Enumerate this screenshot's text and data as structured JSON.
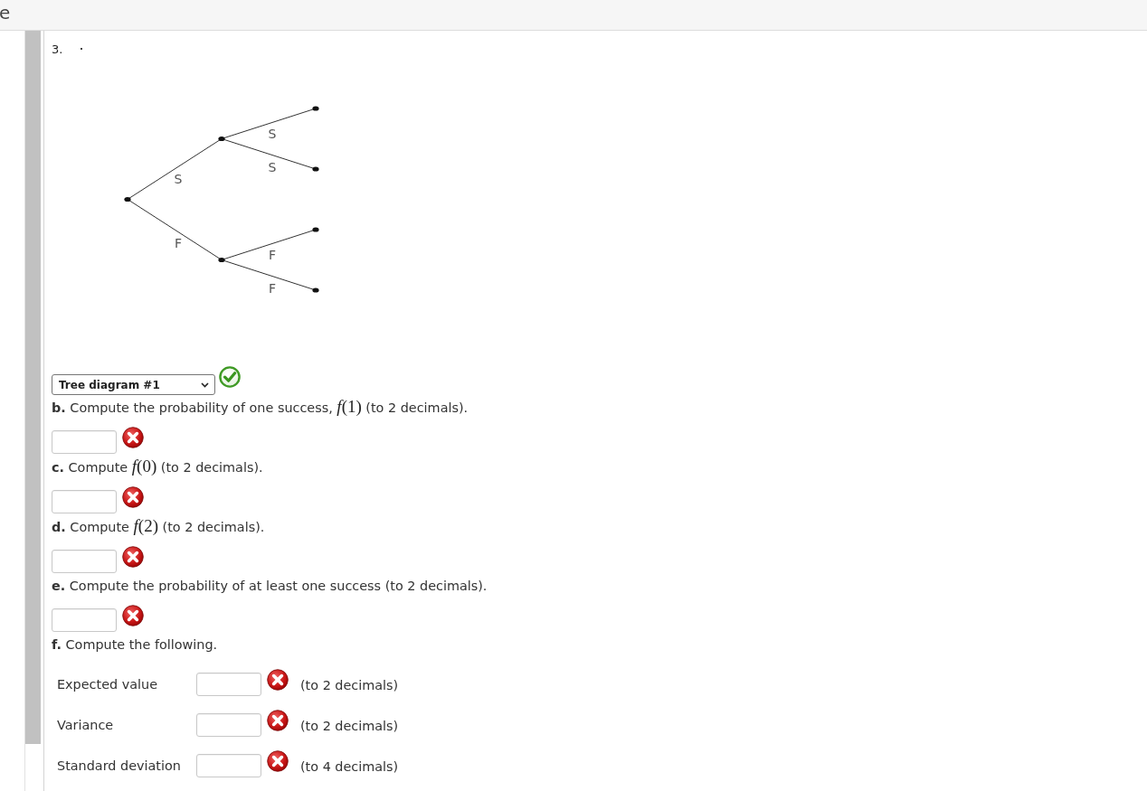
{
  "header": {
    "title": "e"
  },
  "question": {
    "number": "3.",
    "tree": {
      "children": [
        {
          "label": "S",
          "children": [
            {
              "label": "S"
            },
            {
              "label": "S"
            }
          ]
        },
        {
          "label": "F",
          "children": [
            {
              "label": "F"
            },
            {
              "label": "F"
            }
          ]
        }
      ]
    }
  },
  "diagram_select": {
    "value": "Tree diagram #1",
    "correct": true
  },
  "parts": [
    {
      "prompt": [
        {
          "kind": "letter",
          "text": "b."
        },
        {
          "kind": "text",
          "text": " Compute the probability of one success, "
        },
        {
          "kind": "math",
          "text": "*f*(1)"
        },
        {
          "kind": "text",
          "text": " (to 2 decimals)."
        }
      ],
      "answer": {
        "correct": false
      }
    },
    {
      "prompt": [
        {
          "kind": "letter",
          "text": "c."
        },
        {
          "kind": "text",
          "text": " Compute "
        },
        {
          "kind": "math",
          "text": "*f*(0)"
        },
        {
          "kind": "text",
          "text": " (to 2 decimals)."
        }
      ],
      "answer": {
        "correct": false
      }
    },
    {
      "prompt": [
        {
          "kind": "letter",
          "text": "d."
        },
        {
          "kind": "text",
          "text": " Compute "
        },
        {
          "kind": "math",
          "text": "*f*(2)"
        },
        {
          "kind": "text",
          "text": " (to 2 decimals)."
        }
      ],
      "answer": {
        "correct": false
      }
    },
    {
      "prompt": [
        {
          "kind": "letter",
          "text": "e."
        },
        {
          "kind": "text",
          "text": " Compute the probability of at least one success (to 2 decimals)."
        }
      ],
      "answer": {
        "correct": false
      }
    }
  ],
  "part_f": {
    "prompt": [
      {
        "kind": "letter",
        "text": "f."
      },
      {
        "kind": "text",
        "text": " Compute the following."
      }
    ],
    "rows": [
      {
        "label": "Expected value",
        "correct": false,
        "hint": "(to 2 decimals)"
      },
      {
        "label": "Variance",
        "correct": false,
        "hint": "(to 2 decimals)"
      },
      {
        "label": "Standard deviation",
        "correct": false,
        "hint": "(to 4 decimals)"
      }
    ]
  }
}
